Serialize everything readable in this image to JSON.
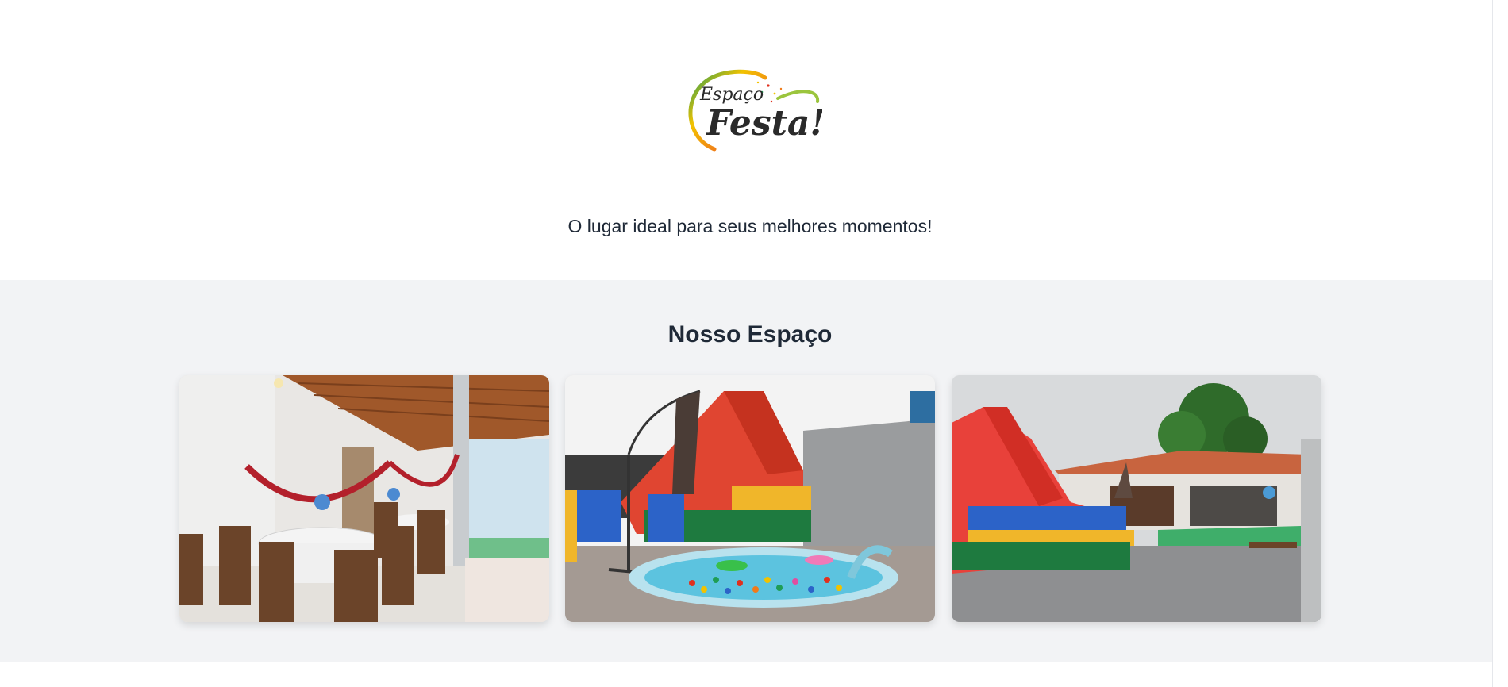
{
  "hero": {
    "logo": {
      "line1": "Espaço",
      "line2": "Festa!"
    },
    "tagline": "O lugar ideal para seus melhores momentos!"
  },
  "gallery": {
    "title": "Nosso Espaço",
    "photos": [
      {
        "icon": "indoor-dining-hall-photo"
      },
      {
        "icon": "inflatable-slide-and-ball-pool-photo"
      },
      {
        "icon": "inflatable-slide-outdoor-patio-photo"
      }
    ]
  },
  "colors": {
    "text": "#1f2937",
    "section_bg": "#f2f3f5",
    "logo_ring_green": "#1f9d55",
    "logo_ring_yellow": "#f2c200",
    "logo_ring_red": "#e0301e"
  }
}
